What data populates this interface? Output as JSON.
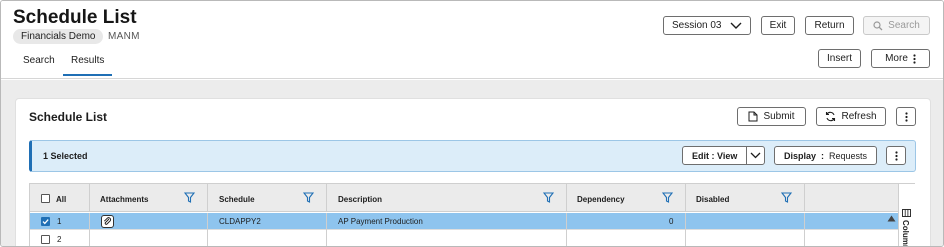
{
  "header": {
    "title": "Schedule List",
    "badge": "Financials Demo",
    "subtitle": "MANM",
    "tabs": [
      {
        "label": "Search",
        "active": false
      },
      {
        "label": "Results",
        "active": true
      }
    ],
    "session_label": "Session 03",
    "exit_label": "Exit",
    "return_label": "Return",
    "search_label": "Search",
    "insert_label": "Insert",
    "more_label": "More"
  },
  "card": {
    "title": "Schedule List",
    "submit_label": "Submit",
    "refresh_label": "Refresh",
    "selected_text": "1 Selected",
    "edit_label": "Edit : View",
    "display_label": "Display",
    "display_value": "Requests"
  },
  "grid": {
    "columns": [
      "All",
      "Attachments",
      "Schedule",
      "Description",
      "Dependency",
      "Disabled"
    ],
    "rows": [
      {
        "num": "1",
        "selected": true,
        "attachment_icon": "paperclip-icon",
        "schedule": "CLDAPPY2",
        "description": "AP Payment Production",
        "dependency": "0",
        "disabled": ""
      },
      {
        "num": "2",
        "selected": false,
        "attachment_icon": "",
        "schedule": "",
        "description": "",
        "dependency": "",
        "disabled": ""
      }
    ],
    "side_label": "Columns"
  },
  "colors": {
    "accent": "#1f6fb5",
    "selected_row": "#8ec4ee",
    "selection_bar": "#dcedf9"
  }
}
